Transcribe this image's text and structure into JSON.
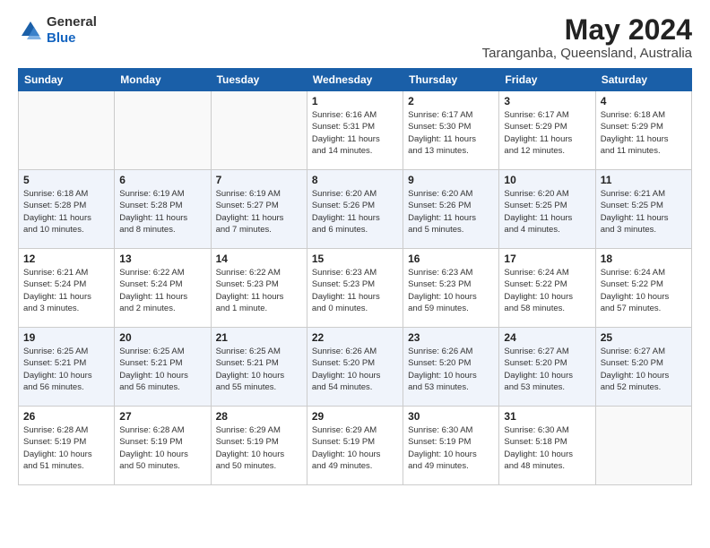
{
  "header": {
    "logo_line1": "General",
    "logo_line2": "Blue",
    "month_title": "May 2024",
    "location": "Taranganba, Queensland, Australia"
  },
  "weekdays": [
    "Sunday",
    "Monday",
    "Tuesday",
    "Wednesday",
    "Thursday",
    "Friday",
    "Saturday"
  ],
  "weeks": [
    [
      {
        "day": "",
        "info": ""
      },
      {
        "day": "",
        "info": ""
      },
      {
        "day": "",
        "info": ""
      },
      {
        "day": "1",
        "info": "Sunrise: 6:16 AM\nSunset: 5:31 PM\nDaylight: 11 hours\nand 14 minutes."
      },
      {
        "day": "2",
        "info": "Sunrise: 6:17 AM\nSunset: 5:30 PM\nDaylight: 11 hours\nand 13 minutes."
      },
      {
        "day": "3",
        "info": "Sunrise: 6:17 AM\nSunset: 5:29 PM\nDaylight: 11 hours\nand 12 minutes."
      },
      {
        "day": "4",
        "info": "Sunrise: 6:18 AM\nSunset: 5:29 PM\nDaylight: 11 hours\nand 11 minutes."
      }
    ],
    [
      {
        "day": "5",
        "info": "Sunrise: 6:18 AM\nSunset: 5:28 PM\nDaylight: 11 hours\nand 10 minutes."
      },
      {
        "day": "6",
        "info": "Sunrise: 6:19 AM\nSunset: 5:28 PM\nDaylight: 11 hours\nand 8 minutes."
      },
      {
        "day": "7",
        "info": "Sunrise: 6:19 AM\nSunset: 5:27 PM\nDaylight: 11 hours\nand 7 minutes."
      },
      {
        "day": "8",
        "info": "Sunrise: 6:20 AM\nSunset: 5:26 PM\nDaylight: 11 hours\nand 6 minutes."
      },
      {
        "day": "9",
        "info": "Sunrise: 6:20 AM\nSunset: 5:26 PM\nDaylight: 11 hours\nand 5 minutes."
      },
      {
        "day": "10",
        "info": "Sunrise: 6:20 AM\nSunset: 5:25 PM\nDaylight: 11 hours\nand 4 minutes."
      },
      {
        "day": "11",
        "info": "Sunrise: 6:21 AM\nSunset: 5:25 PM\nDaylight: 11 hours\nand 3 minutes."
      }
    ],
    [
      {
        "day": "12",
        "info": "Sunrise: 6:21 AM\nSunset: 5:24 PM\nDaylight: 11 hours\nand 3 minutes."
      },
      {
        "day": "13",
        "info": "Sunrise: 6:22 AM\nSunset: 5:24 PM\nDaylight: 11 hours\nand 2 minutes."
      },
      {
        "day": "14",
        "info": "Sunrise: 6:22 AM\nSunset: 5:23 PM\nDaylight: 11 hours\nand 1 minute."
      },
      {
        "day": "15",
        "info": "Sunrise: 6:23 AM\nSunset: 5:23 PM\nDaylight: 11 hours\nand 0 minutes."
      },
      {
        "day": "16",
        "info": "Sunrise: 6:23 AM\nSunset: 5:23 PM\nDaylight: 10 hours\nand 59 minutes."
      },
      {
        "day": "17",
        "info": "Sunrise: 6:24 AM\nSunset: 5:22 PM\nDaylight: 10 hours\nand 58 minutes."
      },
      {
        "day": "18",
        "info": "Sunrise: 6:24 AM\nSunset: 5:22 PM\nDaylight: 10 hours\nand 57 minutes."
      }
    ],
    [
      {
        "day": "19",
        "info": "Sunrise: 6:25 AM\nSunset: 5:21 PM\nDaylight: 10 hours\nand 56 minutes."
      },
      {
        "day": "20",
        "info": "Sunrise: 6:25 AM\nSunset: 5:21 PM\nDaylight: 10 hours\nand 56 minutes."
      },
      {
        "day": "21",
        "info": "Sunrise: 6:25 AM\nSunset: 5:21 PM\nDaylight: 10 hours\nand 55 minutes."
      },
      {
        "day": "22",
        "info": "Sunrise: 6:26 AM\nSunset: 5:20 PM\nDaylight: 10 hours\nand 54 minutes."
      },
      {
        "day": "23",
        "info": "Sunrise: 6:26 AM\nSunset: 5:20 PM\nDaylight: 10 hours\nand 53 minutes."
      },
      {
        "day": "24",
        "info": "Sunrise: 6:27 AM\nSunset: 5:20 PM\nDaylight: 10 hours\nand 53 minutes."
      },
      {
        "day": "25",
        "info": "Sunrise: 6:27 AM\nSunset: 5:20 PM\nDaylight: 10 hours\nand 52 minutes."
      }
    ],
    [
      {
        "day": "26",
        "info": "Sunrise: 6:28 AM\nSunset: 5:19 PM\nDaylight: 10 hours\nand 51 minutes."
      },
      {
        "day": "27",
        "info": "Sunrise: 6:28 AM\nSunset: 5:19 PM\nDaylight: 10 hours\nand 50 minutes."
      },
      {
        "day": "28",
        "info": "Sunrise: 6:29 AM\nSunset: 5:19 PM\nDaylight: 10 hours\nand 50 minutes."
      },
      {
        "day": "29",
        "info": "Sunrise: 6:29 AM\nSunset: 5:19 PM\nDaylight: 10 hours\nand 49 minutes."
      },
      {
        "day": "30",
        "info": "Sunrise: 6:30 AM\nSunset: 5:19 PM\nDaylight: 10 hours\nand 49 minutes."
      },
      {
        "day": "31",
        "info": "Sunrise: 6:30 AM\nSunset: 5:18 PM\nDaylight: 10 hours\nand 48 minutes."
      },
      {
        "day": "",
        "info": ""
      }
    ]
  ]
}
